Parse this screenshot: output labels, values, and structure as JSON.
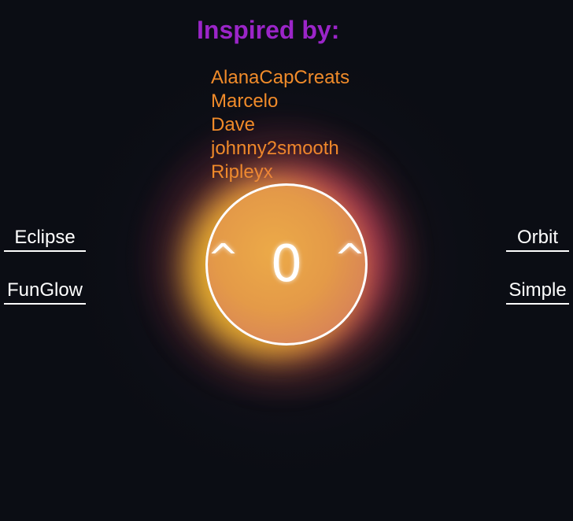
{
  "heading": "Inspired by:",
  "credits": [
    "AlanaCapCreats",
    "Marcelo",
    "Dave",
    "johnny2smooth",
    "Ripleyx"
  ],
  "face": {
    "left_eye": "^",
    "mouth": "0",
    "right_eye": "^"
  },
  "left_links": {
    "eclipse": "Eclipse",
    "funglow": "FunGlow"
  },
  "right_links": {
    "orbit": "Orbit",
    "simple": "Simple"
  },
  "colors": {
    "background": "#0b0d14",
    "heading": "#9b25c8",
    "credits": "#f08b2a",
    "orb_core": "#e49a48",
    "glow_yellow": "#ffd228",
    "glow_pink": "#d2326e",
    "link": "#ffffff"
  }
}
